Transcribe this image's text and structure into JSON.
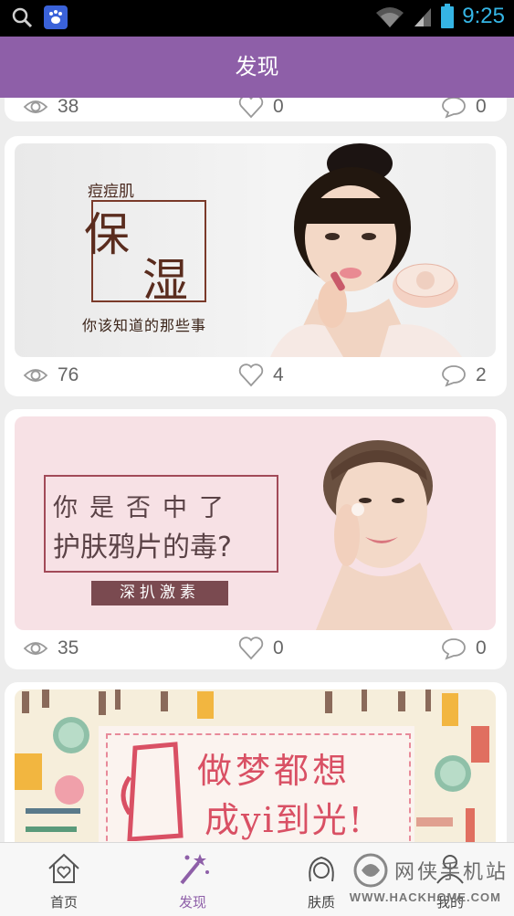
{
  "status_bar": {
    "time": "9:25",
    "icons": [
      "search-icon",
      "baidu-icon",
      "wifi-icon",
      "signal-icon",
      "battery-icon"
    ]
  },
  "header": {
    "title": "发现"
  },
  "feed": {
    "cards": [
      {
        "views": "38",
        "likes": "0",
        "comments": "0"
      },
      {
        "banner": {
          "line1": "痘痘肌",
          "char1": "保",
          "char2": "湿",
          "line3": "你该知道的那些事"
        },
        "views": "76",
        "likes": "4",
        "comments": "2"
      },
      {
        "banner": {
          "line1": "你是否中了",
          "line2": "护肤鸦片的毒?",
          "tag": "深扒激素"
        },
        "views": "35",
        "likes": "0",
        "comments": "0"
      },
      {
        "banner": {
          "line1": "做梦都想",
          "line2": "成yi到光!"
        }
      }
    ]
  },
  "bottom_nav": {
    "items": [
      {
        "label": "首页",
        "icon": "home-icon"
      },
      {
        "label": "发现",
        "icon": "magic-wand-icon",
        "active": true
      },
      {
        "label": "肤质",
        "icon": "face-icon"
      },
      {
        "label": "我的",
        "icon": "profile-icon"
      }
    ]
  },
  "watermark": {
    "text": "网侠手机站",
    "url": "WWW.HACKHOME.COM"
  },
  "colors": {
    "primary": "#8e5fa8",
    "accent_blue": "#35b5e5",
    "background": "#ededed"
  }
}
